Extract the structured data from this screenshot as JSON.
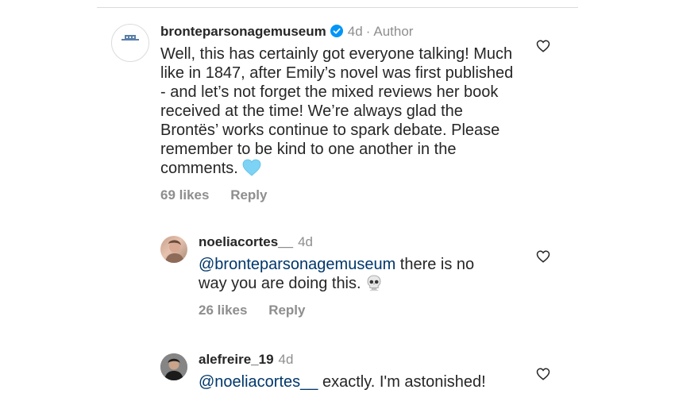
{
  "comments": [
    {
      "username": "bronteparsonagemuseum",
      "verified": true,
      "time": "4d",
      "role": "Author",
      "text": "Well, this has certainly got everyone talking! Much like in 1847, after Emily’s novel was first published - and let’s not forget the mixed reviews her book received at the time! We’re always glad the Brontës’ works continue to spark debate. Please remember to be kind to one another in the comments.",
      "emoji": "light-blue-heart",
      "likes": "69 likes",
      "reply": "Reply",
      "avatar_text": "Brontë Parsonage MUSEUM"
    },
    {
      "username": "noeliacortes__",
      "time": "4d",
      "mention": "@bronteparsonagemuseum",
      "text_after_mention": " there is no",
      "text_line2": "way you are doing this.",
      "emoji": "skull",
      "likes": "26 likes",
      "reply": "Reply"
    },
    {
      "username": "alefreire_19",
      "time": "4d",
      "mention": "@noeliacortes__",
      "text_after_mention": " exactly. I'm astonished!"
    }
  ],
  "colors": {
    "text": "#262626",
    "muted": "#8e8e8e",
    "mention": "#00376b",
    "verified": "#0095f6",
    "divider": "#dbdbdb"
  }
}
